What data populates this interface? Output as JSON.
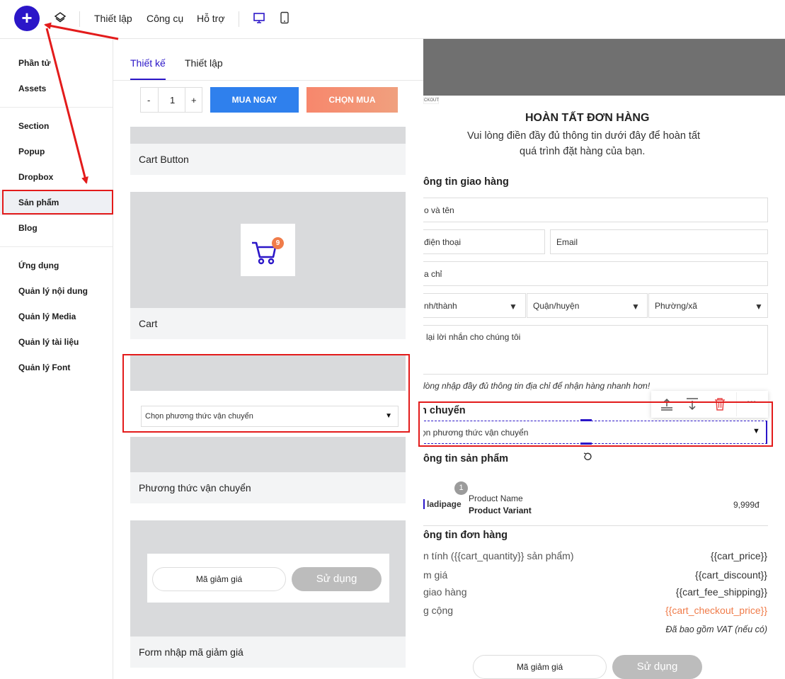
{
  "topbar": {
    "menu": [
      "Thiết lập",
      "Công cụ",
      "Hỗ trợ"
    ]
  },
  "sidebar": {
    "group1": [
      "Phần tử",
      "Assets"
    ],
    "group2": [
      "Section",
      "Popup",
      "Dropbox",
      "Sản phẩm",
      "Blog"
    ],
    "group3": [
      "Ứng dụng",
      "Quản lý nội dung",
      "Quản lý Media",
      "Quản lý tài liệu",
      "Quản lý Font"
    ]
  },
  "panel": {
    "tabs": [
      "Thiết kế",
      "Thiết lập"
    ],
    "qty_minus": "-",
    "qty_value": "1",
    "qty_plus": "+",
    "buy_now": "MUA NGAY",
    "choose_buy": "CHỌN MUA",
    "cart_button_label": "Cart Button",
    "cart_badge": "9",
    "cart_label": "Cart",
    "shipping_select": "Chọn phương thức vận chuyển",
    "shipping_label": "Phương thức vận chuyển",
    "coupon_placeholder": "Mã giảm giá",
    "coupon_apply": "Sử dụng",
    "coupon_label": "Form nhập mã giảm giá"
  },
  "canvas": {
    "tag": "CKOUT",
    "title": "HOÀN TẤT ĐƠN HÀNG",
    "subtitle_line1": "Vui lòng điền đầy đủ thông tin dưới đây để hoàn tất",
    "subtitle_line2": "quá trình đặt hàng của bạn.",
    "shipping_info_heading": "ông tin giao hàng",
    "field_name": "o và tên",
    "field_phone": "điện thoại",
    "field_email": "Email",
    "field_address": "a chỉ",
    "field_city": "nh/thành",
    "field_district": "Quận/huyện",
    "field_ward": "Phường/xã",
    "field_message": "lại lời nhắn cho chúng tôi",
    "address_hint": "lòng nhập đầy đủ thông tin địa chỉ để nhận hàng nhanh hơn!",
    "shipping_heading": "n chuyển",
    "shipping_select": "ọn phương thức vận chuyển",
    "product_info_heading": "ông tin sản phẩm",
    "product_qty_badge": "1",
    "product_logo": "ladipage",
    "product_name": "Product Name",
    "product_variant": "Product Variant",
    "product_price": "9,999đ",
    "order_info_heading": "ông tin đơn hàng",
    "row_subtotal_label": "n tính ({{cart_quantity}} sản phẩm)",
    "row_subtotal_value": "{{cart_price}}",
    "row_discount_label": "m giá",
    "row_discount_value": "{{cart_discount}}",
    "row_shipping_label": "giao hàng",
    "row_shipping_value": "{{cart_fee_shipping}}",
    "row_total_label": "g cộng",
    "row_total_value": "{{cart_checkout_price}}",
    "vat_note": "Đã bao gồm VAT (nếu có)",
    "coupon_placeholder": "Mã giảm giá",
    "coupon_apply": "Sử dụng",
    "toolbar_more": "..."
  },
  "colors": {
    "brand": "#2b16c8",
    "buy_now": "#2f80ed",
    "choose_buy": "#f7876c",
    "annotation_red": "#e31b1b",
    "total_orange": "#f07c4a"
  }
}
